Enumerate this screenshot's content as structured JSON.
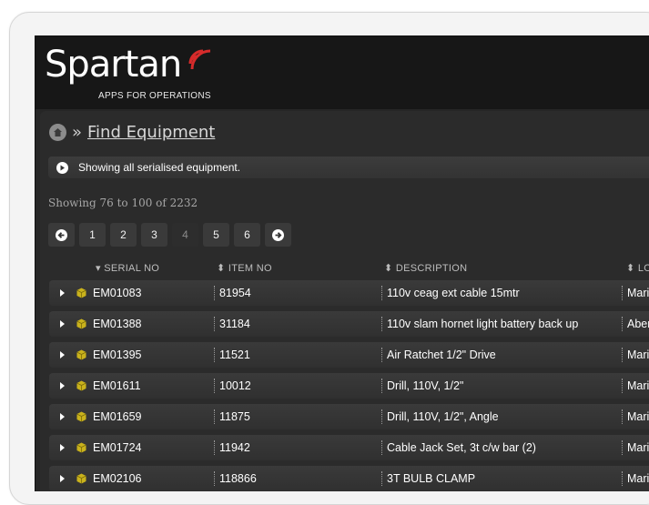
{
  "header": {
    "logo_text": "Spartan",
    "logo_tagline": "APPS FOR OPERATIONS"
  },
  "breadcrumb": {
    "separator": "»",
    "current": "Find Equipment"
  },
  "info_bar": {
    "message": "Showing all serialised equipment."
  },
  "results": {
    "summary": "Showing 76 to 100 of 2232"
  },
  "pagination": {
    "pages": [
      "1",
      "2",
      "3",
      "4",
      "5",
      "6"
    ],
    "current_page": "4"
  },
  "table": {
    "columns": {
      "serial_no": "SERIAL NO",
      "item_no": "ITEM NO",
      "description": "DESCRIPTION",
      "location": "LO"
    },
    "rows": [
      {
        "serial": "EM01083",
        "item": "81954",
        "description": "110v ceag ext cable 15mtr",
        "location": "Mari"
      },
      {
        "serial": "EM01388",
        "item": "31184",
        "description": "110v slam hornet light battery back up",
        "location": "Aber"
      },
      {
        "serial": "EM01395",
        "item": "11521",
        "description": "Air Ratchet 1/2\" Drive",
        "location": "Mari"
      },
      {
        "serial": "EM01611",
        "item": "10012",
        "description": "Drill, 110V, 1/2\"",
        "location": "Mari"
      },
      {
        "serial": "EM01659",
        "item": "11875",
        "description": "Drill, 110V, 1/2\", Angle",
        "location": "Mari"
      },
      {
        "serial": "EM01724",
        "item": "11942",
        "description": "Cable Jack Set, 3t c/w bar (2)",
        "location": "Mari"
      },
      {
        "serial": "EM02106",
        "item": "118866",
        "description": "3T BULB CLAMP",
        "location": "Mari"
      }
    ]
  },
  "colors": {
    "header_bg": "#171717",
    "panel_bg": "#2b2b2b",
    "row_bg": "#363636",
    "logo_accent": "#d62b2b",
    "box_icon": "#c9b21c"
  }
}
